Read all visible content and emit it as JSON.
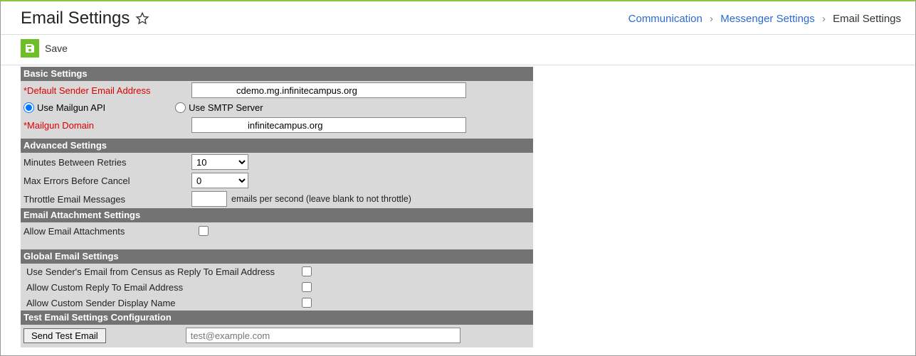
{
  "header": {
    "title": "Email Settings",
    "breadcrumb": {
      "item1": "Communication",
      "item2": "Messenger Settings",
      "current": "Email Settings"
    }
  },
  "toolbar": {
    "save_label": "Save"
  },
  "sections": {
    "basic": {
      "title": "Basic Settings",
      "default_sender_label": "*Default Sender Email Address",
      "default_sender_value": "cdemo.mg.infinitecampus.org",
      "radio_mailgun": "Use Mailgun API",
      "radio_smtp": "Use SMTP Server",
      "mailgun_domain_label": "*Mailgun Domain",
      "mailgun_domain_value": "infinitecampus.org"
    },
    "advanced": {
      "title": "Advanced Settings",
      "minutes_label": "Minutes Between Retries",
      "minutes_value": "10",
      "max_errors_label": "Max Errors Before Cancel",
      "max_errors_value": "0",
      "throttle_label": "Throttle Email Messages",
      "throttle_value": "",
      "throttle_hint": "emails per second (leave blank to not throttle)"
    },
    "attach": {
      "title": "Email Attachment Settings",
      "allow_label": "Allow Email Attachments"
    },
    "global": {
      "title": "Global Email Settings",
      "census_label": "Use Sender's Email from Census as Reply To Email Address",
      "custom_reply_label": "Allow Custom Reply To Email Address",
      "custom_display_label": "Allow Custom Sender Display Name"
    },
    "test": {
      "title": "Test Email Settings Configuration",
      "send_btn": "Send Test Email",
      "placeholder": "test@example.com"
    }
  }
}
